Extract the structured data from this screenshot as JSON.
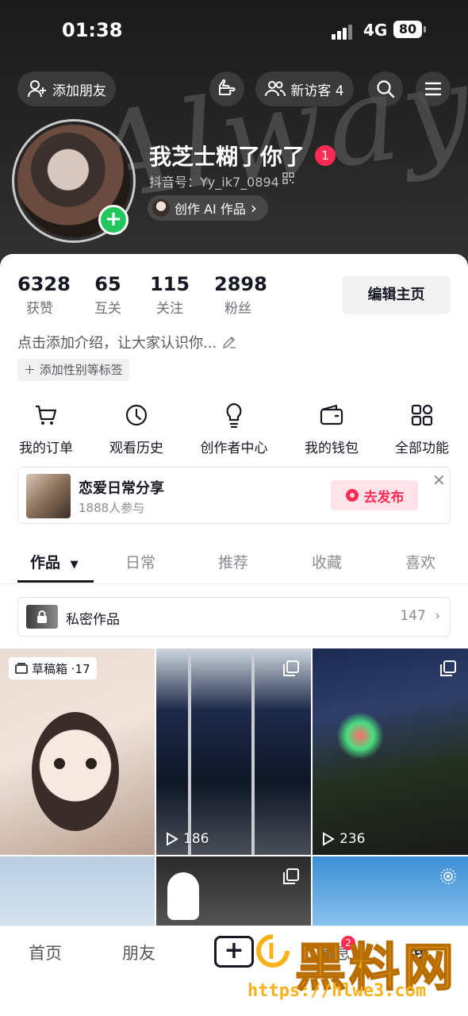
{
  "status_bar": {
    "time": "01:38",
    "network": "4G",
    "battery": "80"
  },
  "header": {
    "background_text": "Always",
    "add_friend_label": "添加朋友",
    "visitor_label": "新访客 4",
    "nickname": "我芝士糊了你了",
    "nickname_badge": "1",
    "douyin_id": "抖音号：Yy_ik7_0894",
    "ai_pill_label": "创作 AI 作品",
    "ai_pill_chevron": "›"
  },
  "stats": [
    {
      "num": "6328",
      "label": "获赞"
    },
    {
      "num": "65",
      "label": "互关"
    },
    {
      "num": "115",
      "label": "关注"
    },
    {
      "num": "2898",
      "label": "粉丝"
    }
  ],
  "edit_profile_label": "编辑主页",
  "intro_text": "点击添加介绍，让大家认识你...",
  "add_tag_label": "＋ 添加性别等标签",
  "functions": [
    {
      "icon": "cart-icon",
      "label": "我的订单"
    },
    {
      "icon": "clock-icon",
      "label": "观看历史"
    },
    {
      "icon": "bulb-icon",
      "label": "创作者中心"
    },
    {
      "icon": "wallet-icon",
      "label": "我的钱包"
    },
    {
      "icon": "grid-icon",
      "label": "全部功能"
    }
  ],
  "banner": {
    "title": "恋爱日常分享",
    "subtitle": "1888人参与",
    "publish_label": "去发布",
    "close": "✕"
  },
  "tabs": [
    {
      "label": "作品",
      "active": true,
      "caret": "▼"
    },
    {
      "label": "日常"
    },
    {
      "label": "推荐"
    },
    {
      "label": "收藏"
    },
    {
      "label": "喜欢"
    }
  ],
  "private_works": {
    "label": "私密作品",
    "count": "147",
    "chevron": "›"
  },
  "grid": {
    "draft_badge": "草稿箱 ·17",
    "items": [
      {
        "play_count": ""
      },
      {
        "play_count": "186"
      },
      {
        "play_count": "236"
      },
      {
        "play_count": ""
      },
      {
        "play_count": ""
      },
      {
        "play_count": ""
      }
    ]
  },
  "bottom_nav": {
    "home": "首页",
    "friends": "朋友",
    "plus": "+",
    "messages": "消息",
    "me": "我",
    "messages_badge": "2"
  },
  "watermark": {
    "text": "黑料网",
    "url": "https://hlwe3.com"
  },
  "colors": {
    "accent": "#fe2c55",
    "green": "#22c55e",
    "watermark": "#f7b21b"
  }
}
